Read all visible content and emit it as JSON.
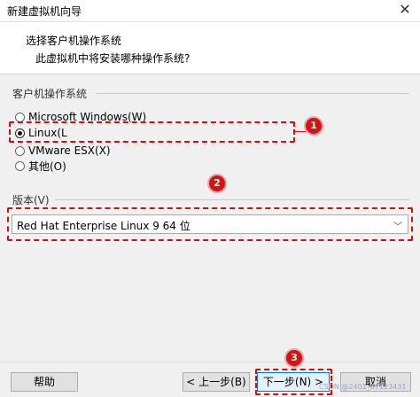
{
  "window": {
    "title": "新建虚拟机向导",
    "close_glyph": "✕"
  },
  "header": {
    "title": "选择客户机操作系统",
    "subtitle": "此虚拟机中将安装哪种操作系统?"
  },
  "os_group": {
    "label": "客户机操作系统",
    "options": [
      {
        "label": "Microsoft Windows(W)",
        "checked": false
      },
      {
        "label": "Linux(L",
        "checked": true
      },
      {
        "label": "VMware ESX(X)",
        "checked": false
      },
      {
        "label": "其他(O)",
        "checked": false
      }
    ]
  },
  "version_group": {
    "label": "版本(V)",
    "selected": "Red Hat Enterprise Linux 9 64 位",
    "chevron": "﹀"
  },
  "annotations": {
    "badge1": "1",
    "badge2": "2",
    "badge3": "3",
    "color": "#d01515"
  },
  "buttons": {
    "help": "帮助",
    "back": "< 上一步(B)",
    "next": "下一步(N) >",
    "cancel": "取消"
  },
  "watermark": "CSDN @2401_87123431"
}
